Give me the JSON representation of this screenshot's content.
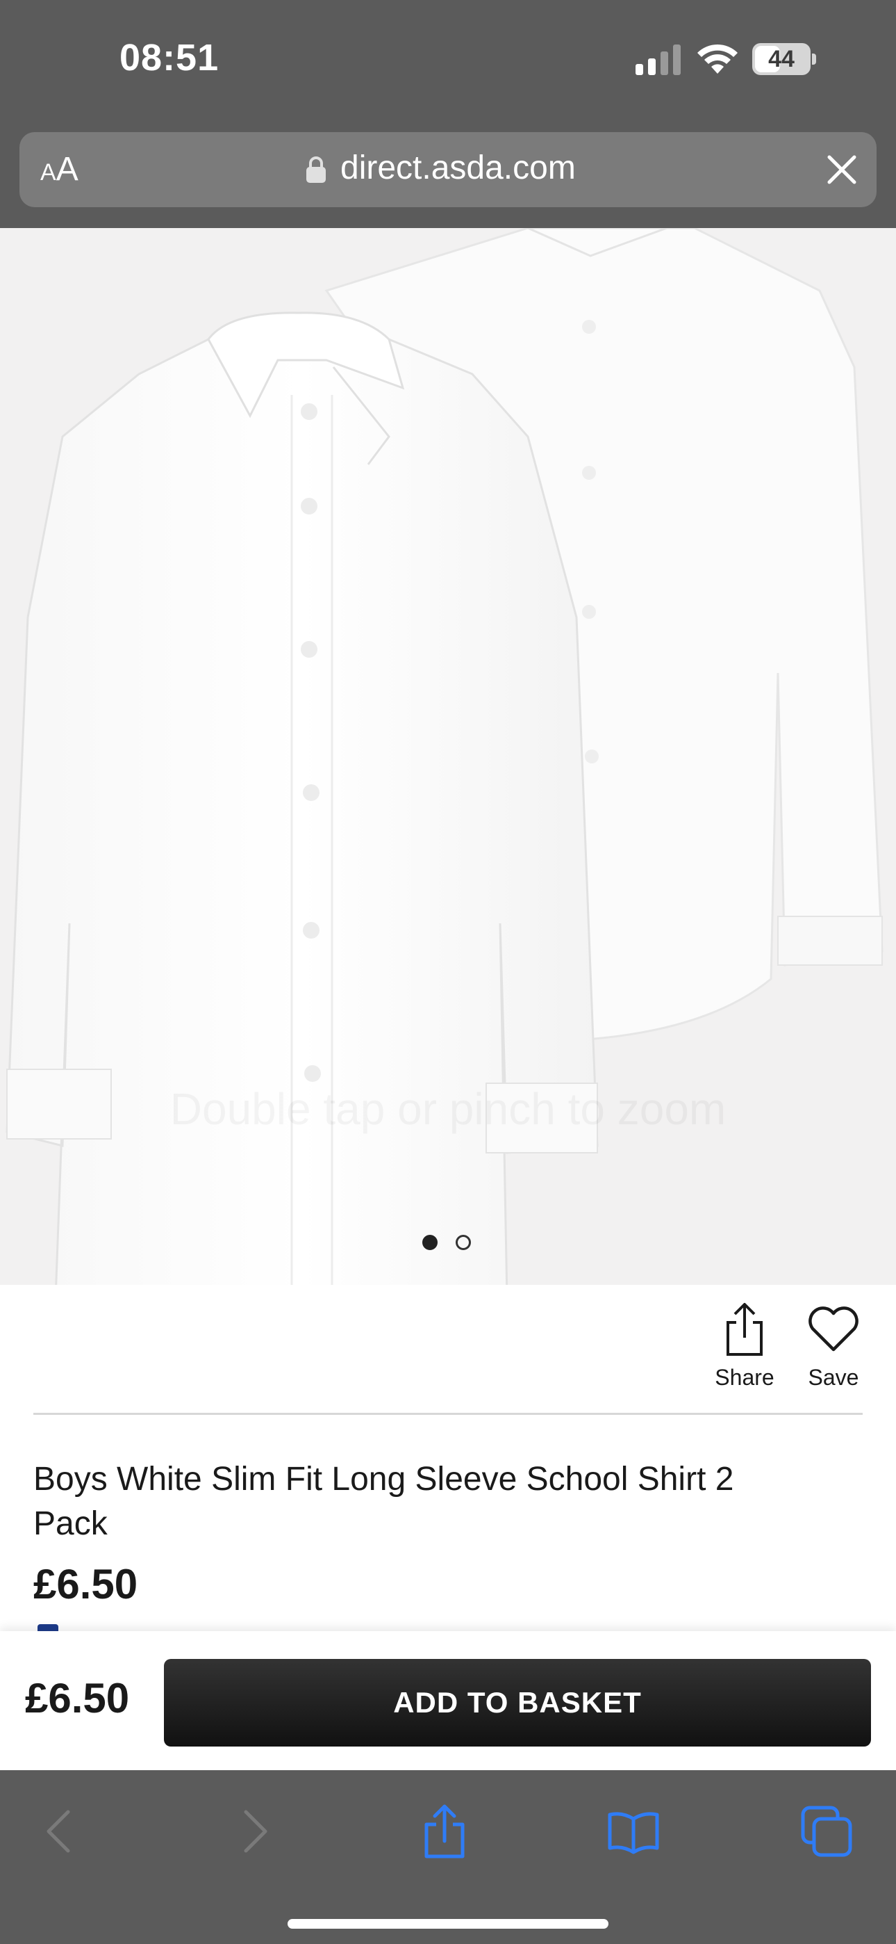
{
  "status_bar": {
    "time": "08:51",
    "battery": "44"
  },
  "browser": {
    "aa_small": "A",
    "aa_big": "A",
    "url": "direct.asda.com"
  },
  "gallery": {
    "watermark": "Double tap or pinch to zoom",
    "dots": 2,
    "active_dot": 1
  },
  "actions": {
    "share_label": "Share",
    "save_label": "Save"
  },
  "product": {
    "title": "Boys White Slim Fit Long Sleeve School Shirt 2 Pack",
    "price": "£6.50"
  },
  "basket_bar": {
    "price": "£6.50",
    "button_label": "ADD TO BASKET"
  },
  "colors": {
    "chrome": "#5b5b5b",
    "toolbar_icon": "#2f7cf6",
    "button": "#1a1a1a",
    "gallery_bg": "#f2f1f1"
  },
  "icons": {
    "signal": "signal-icon",
    "wifi": "wifi-icon",
    "battery": "battery-icon",
    "lock": "lock-icon",
    "close": "close-icon",
    "share": "share-icon",
    "save": "heart-icon",
    "back": "chevron-left-icon",
    "forward": "chevron-right-icon",
    "bookmarks": "book-icon",
    "tabs": "tabs-icon"
  }
}
